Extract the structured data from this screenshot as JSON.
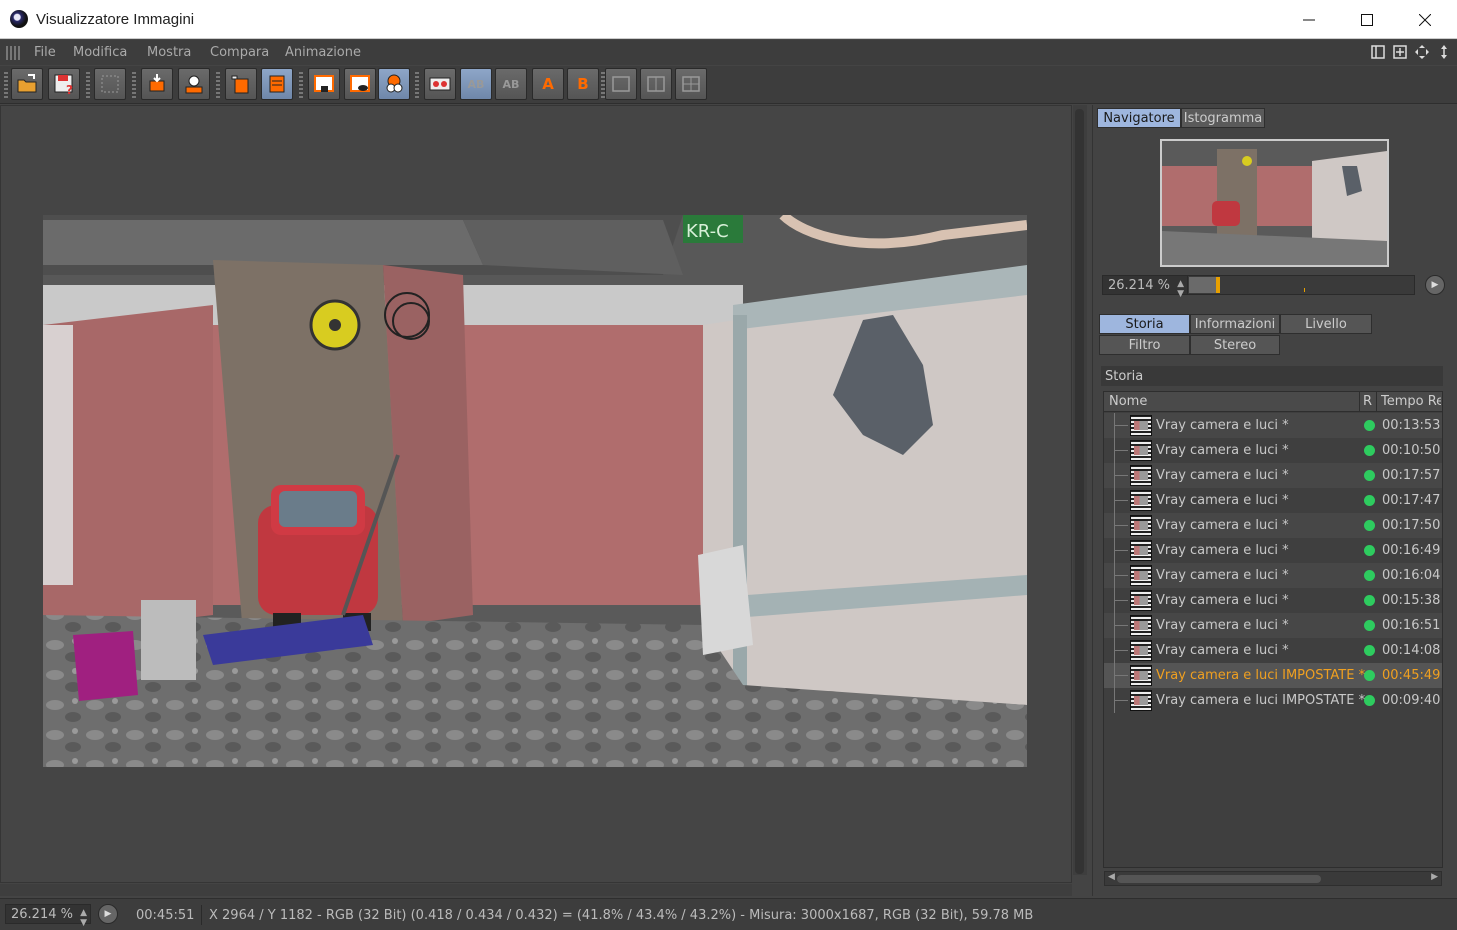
{
  "window": {
    "title": "Visualizzatore Immagini",
    "minimize": "—",
    "maximize": "☐",
    "close": "✕"
  },
  "menu": {
    "items": [
      "File",
      "Modifica",
      "Mostra",
      "Compara",
      "Animazione"
    ]
  },
  "toolbar": {
    "buttons": [
      "open-icon",
      "save-icon",
      "grid-icon",
      "crop-icon",
      "user-icon",
      "copy-icon",
      "stack-icon",
      "region-icon",
      "region-eye-icon",
      "layers-icon",
      "ab-icon",
      "ab-split-icon",
      "ab-vertical-icon",
      "set-a-icon",
      "set-b-icon",
      "compare-1-icon",
      "compare-2-icon",
      "compare-3-icon"
    ],
    "ab_label": "AB",
    "a_label": "A",
    "b_label": "B"
  },
  "navigator": {
    "tabs": [
      "Navigatore",
      "Istogramma"
    ],
    "active_tab": "Navigatore",
    "zoom": "26.214 %",
    "slider_fraction": 0.12
  },
  "panel_tabs": {
    "row1": [
      "Storia",
      "Informazioni",
      "Livello"
    ],
    "row2": [
      "Filtro",
      "Stereo"
    ],
    "active": "Storia"
  },
  "history": {
    "section_title": "Storia",
    "columns": [
      "Nome",
      "R",
      "Tempo Re"
    ],
    "rows": [
      {
        "name": "Vray camera e luci *",
        "time": "00:13:53"
      },
      {
        "name": "Vray camera e luci *",
        "time": "00:10:50"
      },
      {
        "name": "Vray camera e luci *",
        "time": "00:17:57"
      },
      {
        "name": "Vray camera e luci *",
        "time": "00:17:47"
      },
      {
        "name": "Vray camera e luci *",
        "time": "00:17:50"
      },
      {
        "name": "Vray camera e luci *",
        "time": "00:16:49"
      },
      {
        "name": "Vray camera e luci *",
        "time": "00:16:04"
      },
      {
        "name": "Vray camera e luci *",
        "time": "00:15:38"
      },
      {
        "name": "Vray camera e luci *",
        "time": "00:16:51"
      },
      {
        "name": "Vray camera e luci *",
        "time": "00:14:08"
      },
      {
        "name": "Vray camera e luci IMPOSTATE *",
        "time": "00:45:49",
        "selected": true
      },
      {
        "name": "Vray camera e luci IMPOSTATE *",
        "time": "00:09:40"
      }
    ]
  },
  "status": {
    "zoom": "26.214 %",
    "time": "00:45:51",
    "info": "X 2964 / Y 1182 - RGB (32 Bit) (0.418 / 0.434 / 0.432) = (41.8% / 43.4% / 43.2%) - Misura: 3000x1687, RGB (32 Bit), 59.78 MB"
  },
  "render_sign": "KR-C",
  "colors": {
    "accent_tab": "#9eb6de",
    "selected_row_text": "#f0a020",
    "status_dot": "#2ecc5f",
    "toolbar_active": "#8ea6c8"
  }
}
